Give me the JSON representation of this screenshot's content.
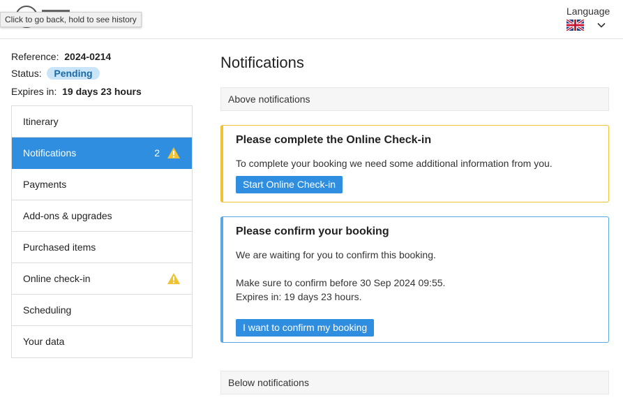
{
  "header": {
    "tooltip": "Click to go back, hold to see history",
    "language_label": "Language",
    "language_flag": "uk-flag-icon"
  },
  "booking": {
    "reference_label": "Reference:",
    "reference_value": "2024-0214",
    "status_label": "Status:",
    "status_value": "Pending",
    "expires_label": "Expires in:",
    "expires_value": "19 days 23 hours"
  },
  "sidebar": {
    "items": [
      {
        "label": "Itinerary"
      },
      {
        "label": "Notifications",
        "count": "2",
        "warning": true,
        "active": true
      },
      {
        "label": "Payments"
      },
      {
        "label": "Add-ons & upgrades"
      },
      {
        "label": "Purchased items"
      },
      {
        "label": "Online check-in",
        "warning": true
      },
      {
        "label": "Scheduling"
      },
      {
        "label": "Your data"
      }
    ]
  },
  "main": {
    "title": "Notifications",
    "above_label": "Above notifications",
    "below_label": "Below notifications",
    "checkin_card": {
      "title": "Please complete the Online Check-in",
      "text": "To complete your booking we need some additional information from you.",
      "button": "Start Online Check-in"
    },
    "confirm_card": {
      "title": "Please confirm your booking",
      "text1": "We are waiting for you to confirm this booking.",
      "text2": "Make sure to confirm before 30 Sep 2024 09:55.",
      "text3": "Expires in: 19 days 23 hours.",
      "button": "I want to confirm my booking"
    }
  },
  "colors": {
    "accent": "#2f8ee0",
    "warning": "#f1c232",
    "info_border": "#5aa7e5",
    "badge_bg": "#c9e5f7"
  }
}
